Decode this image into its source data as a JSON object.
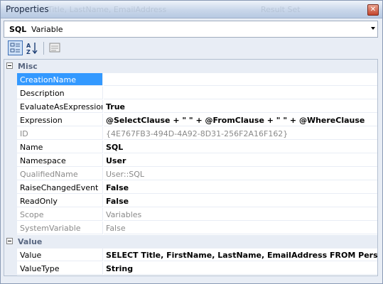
{
  "window": {
    "title": "Properties",
    "background_title": "Title, LastName, EmailAddress",
    "background_title_right": "Result Set",
    "close_glyph": "✕"
  },
  "object_selector": {
    "name": "SQL",
    "type": "Variable"
  },
  "toolbar": {
    "categorized_icon": "categorized-icon",
    "alphabetical_icon": "alphabetical-icon",
    "property_pages_icon": "property-pages-icon"
  },
  "categories": [
    {
      "label": "Misc",
      "properties": [
        {
          "name": "CreationName",
          "value": "",
          "bold": false,
          "readonly": false,
          "selected": true
        },
        {
          "name": "Description",
          "value": "",
          "bold": false,
          "readonly": false,
          "selected": false
        },
        {
          "name": "EvaluateAsExpression",
          "value": "True",
          "bold": true,
          "readonly": false,
          "selected": false
        },
        {
          "name": "Expression",
          "value": "@SelectClause + \" \" + @FromClause + \" \" + @WhereClause",
          "bold": true,
          "readonly": false,
          "selected": false
        },
        {
          "name": "ID",
          "value": "{4E767FB3-494D-4A92-8D31-256F2A16F162}",
          "bold": false,
          "readonly": true,
          "selected": false
        },
        {
          "name": "Name",
          "value": "SQL",
          "bold": true,
          "readonly": false,
          "selected": false
        },
        {
          "name": "Namespace",
          "value": "User",
          "bold": true,
          "readonly": false,
          "selected": false
        },
        {
          "name": "QualifiedName",
          "value": "User::SQL",
          "bold": false,
          "readonly": true,
          "selected": false
        },
        {
          "name": "RaiseChangedEvent",
          "value": "False",
          "bold": true,
          "readonly": false,
          "selected": false
        },
        {
          "name": "ReadOnly",
          "value": "False",
          "bold": true,
          "readonly": false,
          "selected": false
        },
        {
          "name": "Scope",
          "value": "Variables",
          "bold": false,
          "readonly": true,
          "selected": false
        },
        {
          "name": "SystemVariable",
          "value": "False",
          "bold": false,
          "readonly": true,
          "selected": false
        }
      ]
    },
    {
      "label": "Value",
      "properties": [
        {
          "name": "Value",
          "value": "SELECT Title, FirstName, LastName, EmailAddress FROM Person.Conta",
          "bold": true,
          "readonly": false,
          "selected": false
        },
        {
          "name": "ValueType",
          "value": "String",
          "bold": true,
          "readonly": false,
          "selected": false
        }
      ]
    }
  ],
  "colors": {
    "selection": "#3399ff",
    "gutter": "#e8edf5",
    "readonly_text": "#8a8a8a",
    "category_text": "#596781"
  }
}
